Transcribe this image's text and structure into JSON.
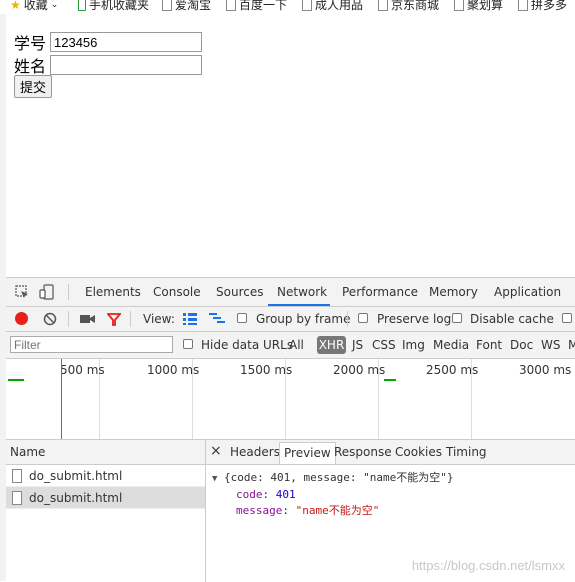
{
  "bookmarks": [
    {
      "label": "收藏",
      "icon": "star-icon"
    },
    {
      "label": "手机收藏夹",
      "icon": "phone-icon"
    },
    {
      "label": "爱淘宝",
      "icon": "page-icon"
    },
    {
      "label": "百度一下",
      "icon": "page-icon"
    },
    {
      "label": "成人用品",
      "icon": "page-icon"
    },
    {
      "label": "京东商城",
      "icon": "page-icon"
    },
    {
      "label": "聚划算",
      "icon": "page-icon"
    },
    {
      "label": "拼多多",
      "icon": "page-icon"
    }
  ],
  "form": {
    "student_id_label": "学号",
    "student_id_value": "123456",
    "name_label": "姓名",
    "name_value": "",
    "submit_label": "提交"
  },
  "devtools": {
    "tabs": [
      "Elements",
      "Console",
      "Sources",
      "Network",
      "Performance",
      "Memory",
      "Application"
    ],
    "active_tab": "Network",
    "toolbar": {
      "view_label": "View:",
      "group_by_frame": "Group by frame",
      "preserve_log": "Preserve log",
      "disable_cache": "Disable cache"
    },
    "filter": {
      "placeholder": "Filter",
      "hide_data_urls": "Hide data URLs",
      "types": [
        "All",
        "XHR",
        "JS",
        "CSS",
        "Img",
        "Media",
        "Font",
        "Doc",
        "WS",
        "M"
      ],
      "active_type": "XHR"
    },
    "timeline_labels": [
      "500 ms",
      "1000 ms",
      "1500 ms",
      "2000 ms",
      "2500 ms",
      "3000 ms"
    ],
    "requests": {
      "header": "Name",
      "items": [
        "do_submit.html",
        "do_submit.html"
      ],
      "selected_index": 1
    },
    "detail": {
      "close": "×",
      "tabs": [
        "Headers",
        "Preview",
        "Response",
        "Cookies",
        "Timing"
      ],
      "active_tab": "Preview",
      "preview_summary": "{code: 401, message: \"name不能为空\"}",
      "code_key": "code",
      "code_value": "401",
      "message_key": "message",
      "message_value": "\"name不能为空\""
    }
  },
  "watermark": "https://blog.csdn.net/lsmxx",
  "colors": {
    "accent": "#1a73e8",
    "record": "#e8201a",
    "xhr_bg": "#777777"
  }
}
